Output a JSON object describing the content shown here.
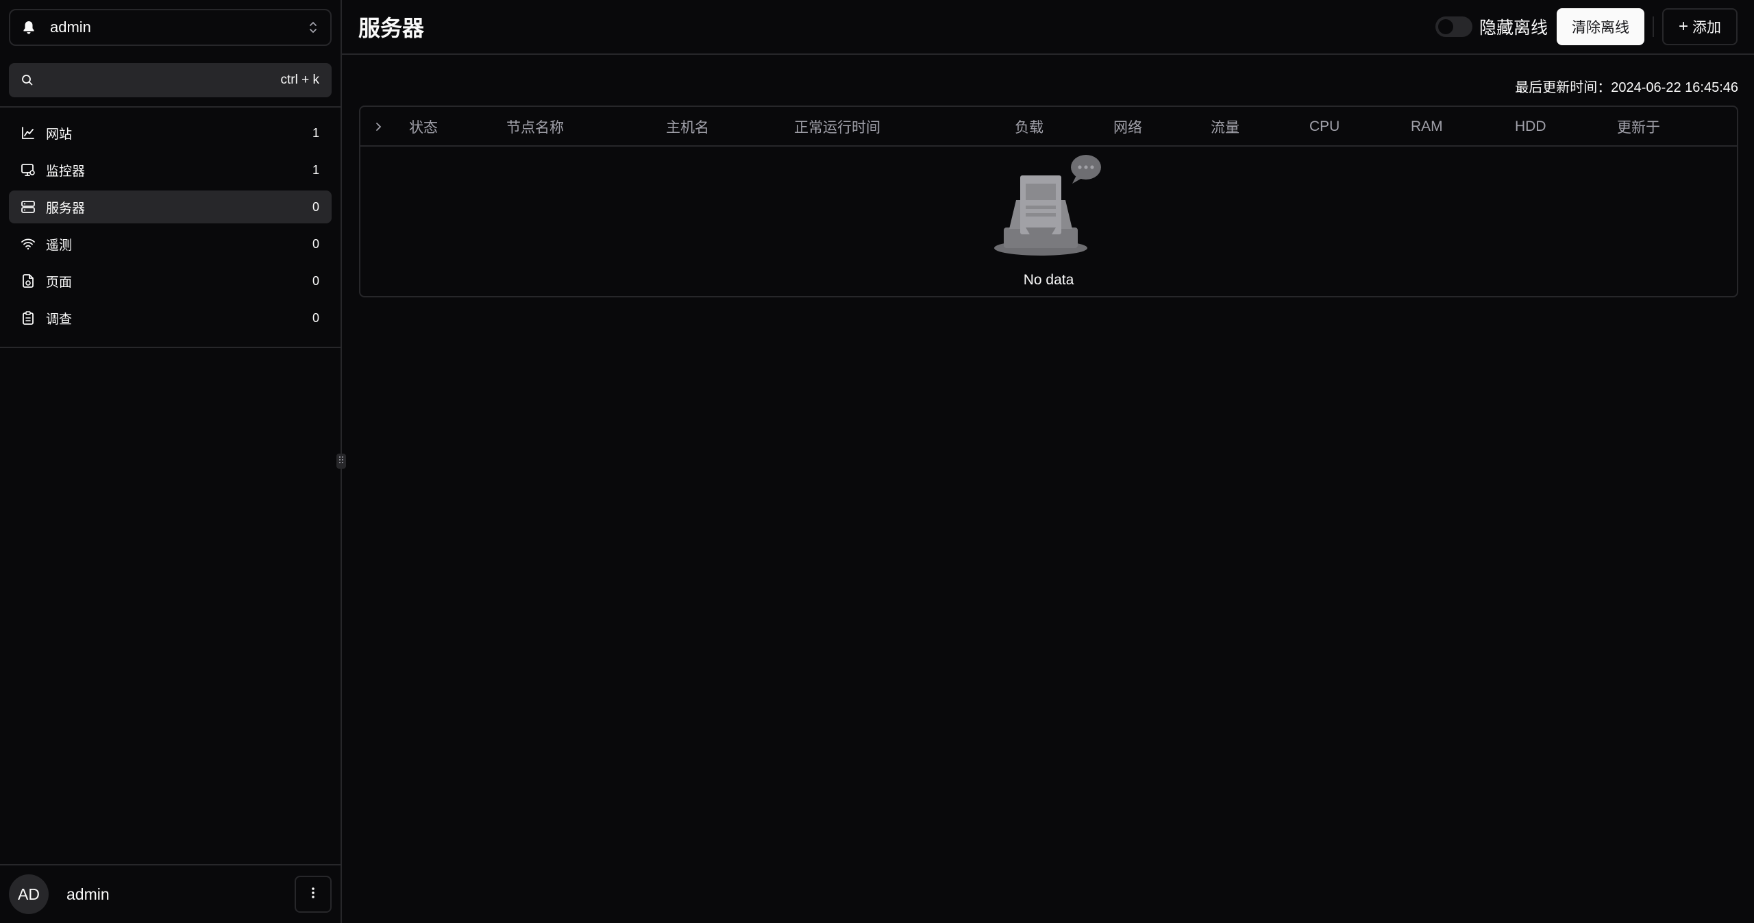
{
  "sidebar": {
    "team_name": "admin",
    "search": {
      "placeholder": "",
      "shortcut": "ctrl + k"
    },
    "items": [
      {
        "label": "网站",
        "count": "1",
        "icon": "chart-icon",
        "active": false
      },
      {
        "label": "监控器",
        "count": "1",
        "icon": "monitor-icon",
        "active": false
      },
      {
        "label": "服务器",
        "count": "0",
        "icon": "server-icon",
        "active": true
      },
      {
        "label": "遥测",
        "count": "0",
        "icon": "wifi-icon",
        "active": false
      },
      {
        "label": "页面",
        "count": "0",
        "icon": "file-icon",
        "active": false
      },
      {
        "label": "调查",
        "count": "0",
        "icon": "clipboard-icon",
        "active": false
      }
    ],
    "user": {
      "avatar_initials": "AD",
      "name": "admin"
    }
  },
  "header": {
    "title": "服务器",
    "hide_offline_label": "隐藏离线",
    "hide_offline_on": false,
    "clear_offline_label": "清除离线",
    "add_label": "添加"
  },
  "main": {
    "last_update": "最后更新时间：2024-06-22 16:45:46",
    "table": {
      "columns": [
        "状态",
        "节点名称",
        "主机名",
        "正常运行时间",
        "负载",
        "网络",
        "流量",
        "CPU",
        "RAM",
        "HDD",
        "更新于"
      ],
      "rows": [],
      "empty_text": "No data"
    }
  },
  "colors": {
    "background": "#09090b",
    "border": "#27272a",
    "foreground": "#fafafa",
    "muted": "#a1a1aa"
  }
}
